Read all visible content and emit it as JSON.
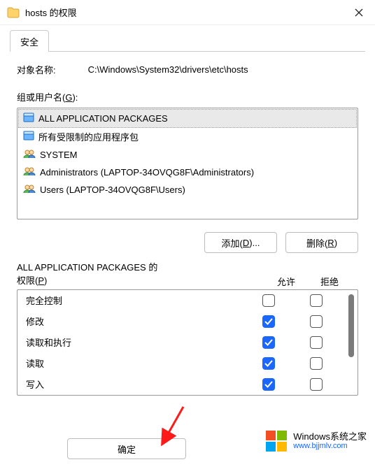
{
  "window": {
    "title": "hosts 的权限"
  },
  "tabs": {
    "security": "安全"
  },
  "object": {
    "label": "对象名称:",
    "path": "C:\\Windows\\System32\\drivers\\etc\\hosts"
  },
  "group": {
    "label_prefix": "组或用户名(",
    "label_accel": "G",
    "label_suffix": "):",
    "items": [
      {
        "icon": "package",
        "text": "ALL APPLICATION PACKAGES",
        "selected": true
      },
      {
        "icon": "package",
        "text": "所有受限制的应用程序包",
        "selected": false
      },
      {
        "icon": "usergroup",
        "text": "SYSTEM",
        "selected": false
      },
      {
        "icon": "usergroup",
        "text": "Administrators (LAPTOP-34OVQG8F\\Administrators)",
        "selected": false
      },
      {
        "icon": "usergroup",
        "text": "Users (LAPTOP-34OVQG8F\\Users)",
        "selected": false
      }
    ]
  },
  "buttons": {
    "add_prefix": "添加(",
    "add_accel": "D",
    "add_suffix": ")...",
    "remove_prefix": "删除(",
    "remove_accel": "R",
    "remove_suffix": ")",
    "ok": "确定"
  },
  "perm": {
    "header_line1": "ALL APPLICATION PACKAGES 的",
    "header_line2_prefix": "权限(",
    "header_line2_accel": "P",
    "header_line2_suffix": ")",
    "col_allow": "允许",
    "col_deny": "拒绝",
    "rows": [
      {
        "name": "完全控制",
        "allow": false,
        "deny": false
      },
      {
        "name": "修改",
        "allow": true,
        "deny": false
      },
      {
        "name": "读取和执行",
        "allow": true,
        "deny": false
      },
      {
        "name": "读取",
        "allow": true,
        "deny": false
      },
      {
        "name": "写入",
        "allow": true,
        "deny": false
      }
    ]
  },
  "watermark": {
    "line1": "Windows系统之家",
    "line2": "www.bjjmlv.com"
  }
}
